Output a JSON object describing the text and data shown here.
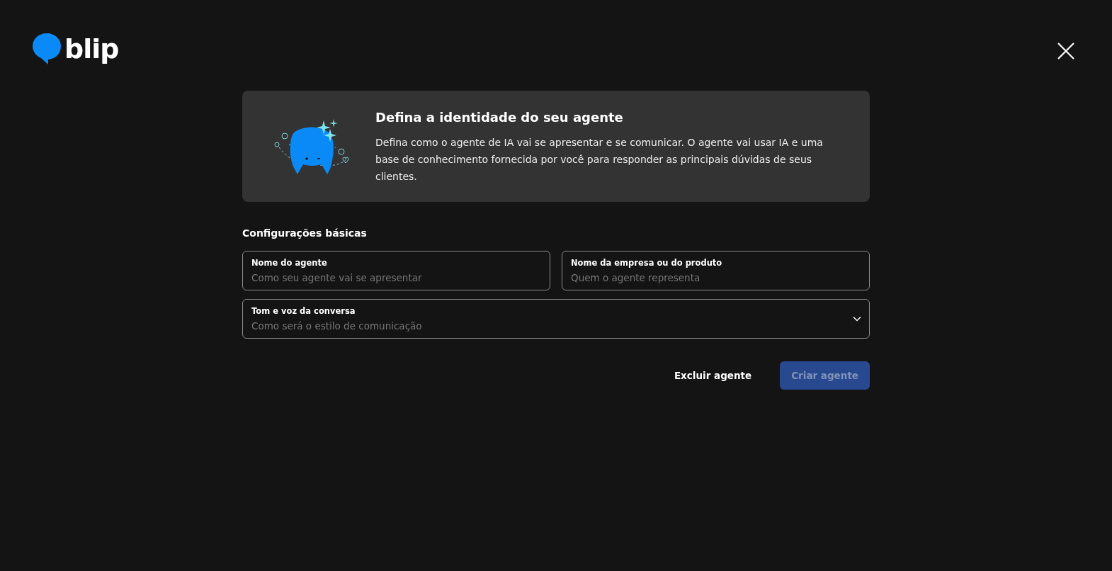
{
  "logo": {
    "text": "blip"
  },
  "intro": {
    "title": "Defina a identidade do seu agente",
    "text": "Defina como o agente de IA vai se apresentar e se comunicar. O agente vai usar IA e uma base de conhecimento fornecida por você para responder as principais dúvidas de seus clientes."
  },
  "section_title": "Configurações básicas",
  "fields": [
    {
      "kind": "text",
      "label": "Nome do agente",
      "placeholder": "Como seu agente vai se apresentar"
    },
    {
      "kind": "text",
      "label": "Nome da empresa ou do produto",
      "placeholder": "Quem o agente representa"
    },
    {
      "kind": "select",
      "label": "Tom e voz da conversa",
      "placeholder": "Como será o estilo de comunicação"
    }
  ],
  "buttons": [
    {
      "kind": "ghost",
      "label": "Excluir agente",
      "disabled": false
    },
    {
      "kind": "primary",
      "label": "Criar agente",
      "disabled": true
    }
  ]
}
